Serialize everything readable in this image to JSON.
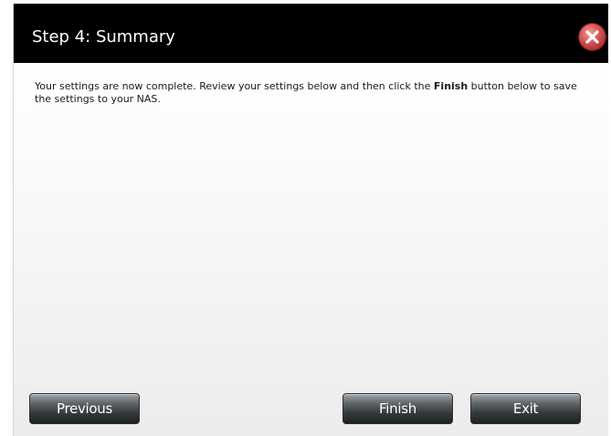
{
  "dialog": {
    "title": "Step 4: Summary",
    "close_icon": "close-icon",
    "message": {
      "before": "Your settings are now complete. Review your settings below and then click the ",
      "bold": "Finish",
      "after": " button below to save the settings to your NAS."
    }
  },
  "buttons": {
    "previous": "Previous",
    "finish": "Finish",
    "exit": "Exit"
  },
  "colors": {
    "titlebar": "#000000",
    "close_button": "#d9534f",
    "button_gradient_top": "#b2b7bb",
    "button_gradient_bottom": "#1c2022"
  }
}
